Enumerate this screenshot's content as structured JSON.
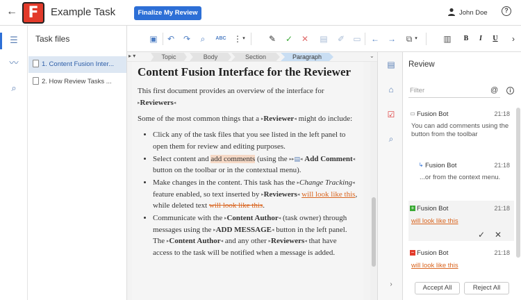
{
  "app": {
    "logo_letter": "F",
    "title": "Example Task",
    "finalize_label": "Finalize My Review",
    "user_name": "John Doe",
    "help_label": "?",
    "back_icon": "back-arrow-icon"
  },
  "task_files": {
    "title": "Task files",
    "items": [
      {
        "label": "1. Content Fusion Inter...",
        "selected": true
      },
      {
        "label": "2. How Review Tasks ...",
        "selected": false
      }
    ]
  },
  "toolbar": {
    "spell_label": "ABC",
    "bold_label": "B",
    "italic_label": "I",
    "underline_label": "U"
  },
  "breadcrumbs": [
    "Topic",
    "Body",
    "Section",
    "Paragraph"
  ],
  "document": {
    "heading": "Content Fusion Interface for the Reviewer",
    "p1_a": "This first document provides an overview of the interface for",
    "p1_b": "Reviewers",
    "p2_a": "Some of the most common things that a",
    "p2_b": "Reviewer",
    "p2_c": "might do include:",
    "li1": "Click any of the task files that you see listed in the left panel to open them for review and editing purposes.",
    "li2_a": "Select content and",
    "li2_hl": "add comments",
    "li2_b": "(using the",
    "li2_c": "Add Comment",
    "li2_d": "button on the toolbar or in the contextual menu).",
    "li3_a": "Make changes in the content. This task has the",
    "li3_i": "Change Tracking",
    "li3_b": "feature enabled, so text inserted by",
    "li3_c": "Reviewers",
    "li3_ins": "will look like this",
    "li3_d": ", while deleted text",
    "li3_del": "will look like this",
    "li3_e": ".",
    "li4_a": "Communicate with the",
    "li4_b": "Content Author",
    "li4_c": "(task owner) through messages using the",
    "li4_d": "ADD MESSAGE",
    "li4_e": "button in the left panel. The",
    "li4_f": "Content Author",
    "li4_g": "and any other",
    "li4_h": "Reviewers",
    "li4_i": "that have access to the task will be notified when a message is added."
  },
  "review": {
    "title": "Review",
    "filter_placeholder": "Filter",
    "at_symbol": "@",
    "info_label": "i",
    "cards": [
      {
        "author": "Fusion Bot",
        "time": "21:18",
        "text": "You can add comments using the button from the toolbar",
        "kind": "comment"
      },
      {
        "author": "Fusion Bot",
        "time": "21:18",
        "text": "...or from the context menu.",
        "kind": "reply"
      },
      {
        "author": "Fusion Bot",
        "time": "21:18",
        "text": "will look like this",
        "kind": "insertion"
      },
      {
        "author": "Fusion Bot",
        "time": "21:18",
        "text": "will look like this",
        "kind": "deletion"
      }
    ],
    "accept_all": "Accept All",
    "reject_all": "Reject All"
  },
  "colors": {
    "accent": "#2d6fd6",
    "logo": "#e23b2b",
    "change": "#d9641e",
    "accept": "#3aaa35",
    "reject": "#e06b6b"
  }
}
